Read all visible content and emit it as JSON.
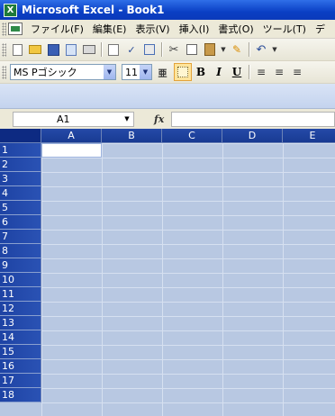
{
  "window": {
    "title": "Microsoft Excel - Book1",
    "icon_label": "X"
  },
  "menubar": {
    "items": [
      "ファイル(F)",
      "編集(E)",
      "表示(V)",
      "挿入(I)",
      "書式(O)",
      "ツール(T)",
      "デ"
    ]
  },
  "toolbar_standard": {
    "icons": [
      "new-icon",
      "open-icon",
      "save-icon",
      "permission-icon",
      "print-icon",
      "print-preview-icon",
      "spelling-icon",
      "research-icon",
      "cut-icon",
      "copy-icon",
      "paste-icon",
      "format-painter-icon",
      "undo-icon"
    ]
  },
  "toolbar_formatting": {
    "font_name": "MS Pゴシック",
    "font_size": "11",
    "bold": "B",
    "italic": "I",
    "underline": "U"
  },
  "formula_bar": {
    "name_box": "A1",
    "fx_label": "fx",
    "formula_value": ""
  },
  "grid": {
    "columns": [
      "A",
      "B",
      "C",
      "D",
      "E"
    ],
    "rows": [
      "1",
      "2",
      "3",
      "4",
      "5",
      "6",
      "7",
      "8",
      "9",
      "10",
      "11",
      "12",
      "13",
      "14",
      "15",
      "16",
      "17",
      "18"
    ],
    "active_cell": "A1"
  },
  "colors": {
    "title_bar": "#0a3fc4",
    "header_bg": "#1e43a4",
    "cell_bg": "#b8c8e2",
    "menu_bg": "#ece9d8"
  }
}
